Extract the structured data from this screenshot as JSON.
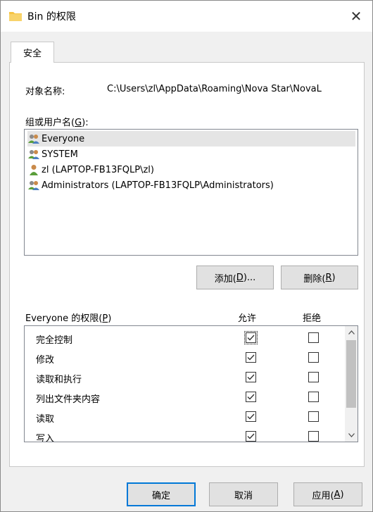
{
  "window": {
    "title": "Bin 的权限",
    "close_glyph": "✕"
  },
  "tabs": [
    {
      "label": "安全"
    }
  ],
  "object_name": {
    "label": "对象名称:",
    "value": "C:\\Users\\zl\\AppData\\Roaming\\Nova Star\\NovaL"
  },
  "groups": {
    "label": "组或用户名(G):",
    "items": [
      {
        "name": "Everyone",
        "icon": "group-icon",
        "selected": true
      },
      {
        "name": "SYSTEM",
        "icon": "group-icon",
        "selected": false
      },
      {
        "name": "zl (LAPTOP-FB13FQLP\\zl)",
        "icon": "user-icon",
        "selected": false
      },
      {
        "name": "Administrators (LAPTOP-FB13FQLP\\Administrators)",
        "icon": "group-icon",
        "selected": false
      }
    ]
  },
  "buttons": {
    "add": "添加(D)...",
    "remove": "删除(R)"
  },
  "permissions": {
    "title": "Everyone 的权限(P)",
    "allow_header": "允许",
    "deny_header": "拒绝",
    "rows": [
      {
        "name": "完全控制",
        "allow": true,
        "deny": false
      },
      {
        "name": "修改",
        "allow": true,
        "deny": false
      },
      {
        "name": "读取和执行",
        "allow": true,
        "deny": false
      },
      {
        "name": "列出文件夹内容",
        "allow": true,
        "deny": false
      },
      {
        "name": "读取",
        "allow": true,
        "deny": false
      },
      {
        "name": "写入",
        "allow": true,
        "deny": false
      }
    ]
  },
  "footer": {
    "ok": "确定",
    "cancel": "取消",
    "apply": "应用(A)"
  },
  "colors": {
    "folder": "#f6c343",
    "group_icon_green": "#5a9e3a",
    "accent": "#0078d7"
  }
}
